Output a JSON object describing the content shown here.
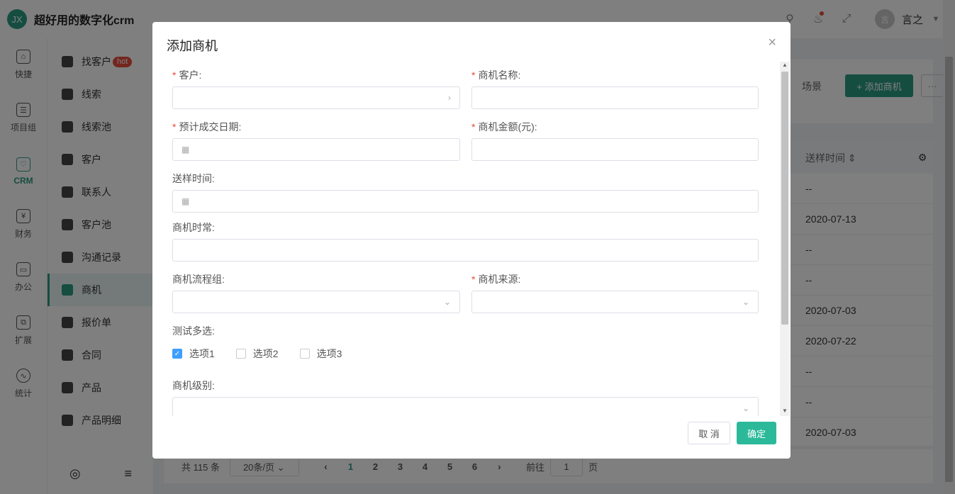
{
  "app": {
    "logo_text": "JX",
    "brand": "超好用的数字化crm"
  },
  "topbar": {
    "search_icon": "search-icon",
    "bell_icon": "bell-icon",
    "fullscreen_icon": "expand-icon",
    "avatar_text": "言",
    "username": "言之"
  },
  "rail": {
    "items": [
      {
        "label": "快捷",
        "icon": "home-icon"
      },
      {
        "label": "项目组",
        "icon": "document-icon"
      },
      {
        "label": "CRM",
        "icon": "heart-icon",
        "active": true
      },
      {
        "label": "财务",
        "icon": "yen-icon"
      },
      {
        "label": "办公",
        "icon": "monitor-icon"
      },
      {
        "label": "扩展",
        "icon": "extend-icon"
      },
      {
        "label": "统计",
        "icon": "chart-icon"
      }
    ]
  },
  "subnav": {
    "items": [
      {
        "label": "找客户",
        "badge": "hot"
      },
      {
        "label": "线索"
      },
      {
        "label": "线索池"
      },
      {
        "label": "客户"
      },
      {
        "label": "联系人"
      },
      {
        "label": "客户池"
      },
      {
        "label": "沟通记录"
      },
      {
        "label": "商机",
        "active": true
      },
      {
        "label": "报价单"
      },
      {
        "label": "合同"
      },
      {
        "label": "产品"
      },
      {
        "label": "产品明细"
      }
    ]
  },
  "main": {
    "scene_label": "场景",
    "add_button": "+ 添加商机",
    "more_button": "···",
    "table": {
      "column": "送样时间 ⇕",
      "rows": [
        "--",
        "2020-07-13",
        "--",
        "--",
        "2020-07-03",
        "2020-07-22",
        "--",
        "--",
        "2020-07-03"
      ]
    },
    "pager": {
      "total": "共 115 条",
      "page_size": "20条/页 ⌄",
      "pages": [
        "1",
        "2",
        "3",
        "4",
        "5",
        "6"
      ],
      "prev": "‹",
      "next": "›",
      "goto_label": "前往",
      "goto_value": "1",
      "goto_suffix": "页"
    }
  },
  "dialog": {
    "title": "添加商机",
    "close": "×",
    "fields": {
      "customer": "客户:",
      "name": "商机名称:",
      "deal_date": "预计成交日期:",
      "amount": "商机金额(元):",
      "sample_time": "送样时间:",
      "duration": "商机时常:",
      "flow_group": "商机流程组:",
      "source": "商机来源:",
      "multi": "测试多选:",
      "level": "商机级别:"
    },
    "required_mark": "*",
    "options": [
      {
        "label": "选项1",
        "checked": true
      },
      {
        "label": "选项2",
        "checked": false
      },
      {
        "label": "选项3",
        "checked": false
      }
    ],
    "cancel": "取 消",
    "ok": "确定"
  }
}
